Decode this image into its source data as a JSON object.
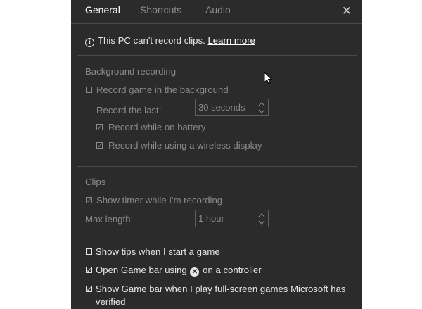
{
  "tabs": [
    "General",
    "Shortcuts",
    "Audio"
  ],
  "close_glyph": "✕",
  "notice": {
    "text": "This PC can't record clips.",
    "link": "Learn more"
  },
  "background_recording": {
    "heading": "Background recording",
    "record_in_background": "Record game in the background",
    "record_the_last_label": "Record the last:",
    "record_the_last_value": "30 seconds",
    "record_on_battery": "Record while on battery",
    "record_wireless_display": "Record while using a wireless display"
  },
  "clips": {
    "heading": "Clips",
    "show_timer": "Show timer while I'm recording",
    "max_length_label": "Max length:",
    "max_length_value": "1 hour"
  },
  "options": {
    "show_tips": "Show tips when I start a game",
    "open_game_bar_pre": "Open Game bar using",
    "open_game_bar_post": "on a controller",
    "show_game_bar_line1": "Show Game bar when I play full-screen games Microsoft has",
    "show_game_bar_line2": "verified"
  },
  "checkbox_states": {
    "record_in_background": false,
    "record_on_battery": true,
    "record_wireless_display": true,
    "show_timer": true,
    "show_tips": false,
    "open_game_bar": true,
    "show_game_bar": true
  },
  "icons": {
    "info": "info-icon",
    "xbox": "xbox-logo-icon",
    "cursor": "mouse-pointer-icon"
  }
}
